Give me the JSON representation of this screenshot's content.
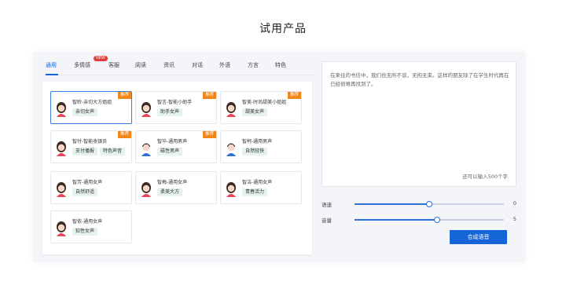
{
  "page": {
    "title": "试用产品"
  },
  "tabs": [
    {
      "label": "通用",
      "active": true
    },
    {
      "label": "多情感",
      "badge": "NEW"
    },
    {
      "label": "客服"
    },
    {
      "label": "阅读"
    },
    {
      "label": "资讯"
    },
    {
      "label": "对话"
    },
    {
      "label": "外语"
    },
    {
      "label": "方言"
    },
    {
      "label": "特色"
    }
  ],
  "voices": [
    {
      "name": "智聆-亲切大方姐姐",
      "tags": [
        "亲切女声"
      ],
      "badge": "推荐",
      "gender": "female",
      "selected": true
    },
    {
      "name": "智言-智能小助手",
      "tags": [
        "助手女声"
      ],
      "badge": "推荐",
      "gender": "female"
    },
    {
      "name": "智美-时尚甜美小姐姐",
      "tags": [
        "甜美女声"
      ],
      "badge": "推荐",
      "gender": "female"
    },
    {
      "name": "智付-智能收银员",
      "tags": [
        "支付播报",
        "特色声音"
      ],
      "badge": "推荐",
      "gender": "female"
    },
    {
      "name": "智华-通用男声",
      "tags": [
        "磁性男声"
      ],
      "badge": "推荐",
      "gender": "male"
    },
    {
      "name": "智柯-通用男声",
      "tags": [
        "自然轻快"
      ],
      "gender": "male"
    },
    {
      "name": "智芳-通用女声",
      "tags": [
        "自然舒适"
      ],
      "gender": "female"
    },
    {
      "name": "智梅-通用女声",
      "tags": [
        "柔美大方"
      ],
      "gender": "female"
    },
    {
      "name": "智洁-通用女声",
      "tags": [
        "青春活力"
      ],
      "gender": "female"
    },
    {
      "name": "智依-通用女声",
      "tags": [
        "知性女声"
      ],
      "gender": "female"
    }
  ],
  "textarea": {
    "content": "在来往的书信中，我们也无所不谈，无拘无束。这样的朋友除了在学生时代再在已经很难再找到了。",
    "hint": "还可以输入500个字"
  },
  "speed": {
    "label": "语速",
    "value": "0",
    "fraction": 0.5
  },
  "volume": {
    "label": "音量",
    "value": "5",
    "fraction": 0.55
  },
  "synth_button": "合成语音",
  "colors": {
    "accent": "#1565d8",
    "badge": "#f0861a",
    "tag_bg": "#e6f2ec",
    "new_badge": "#e53935"
  }
}
